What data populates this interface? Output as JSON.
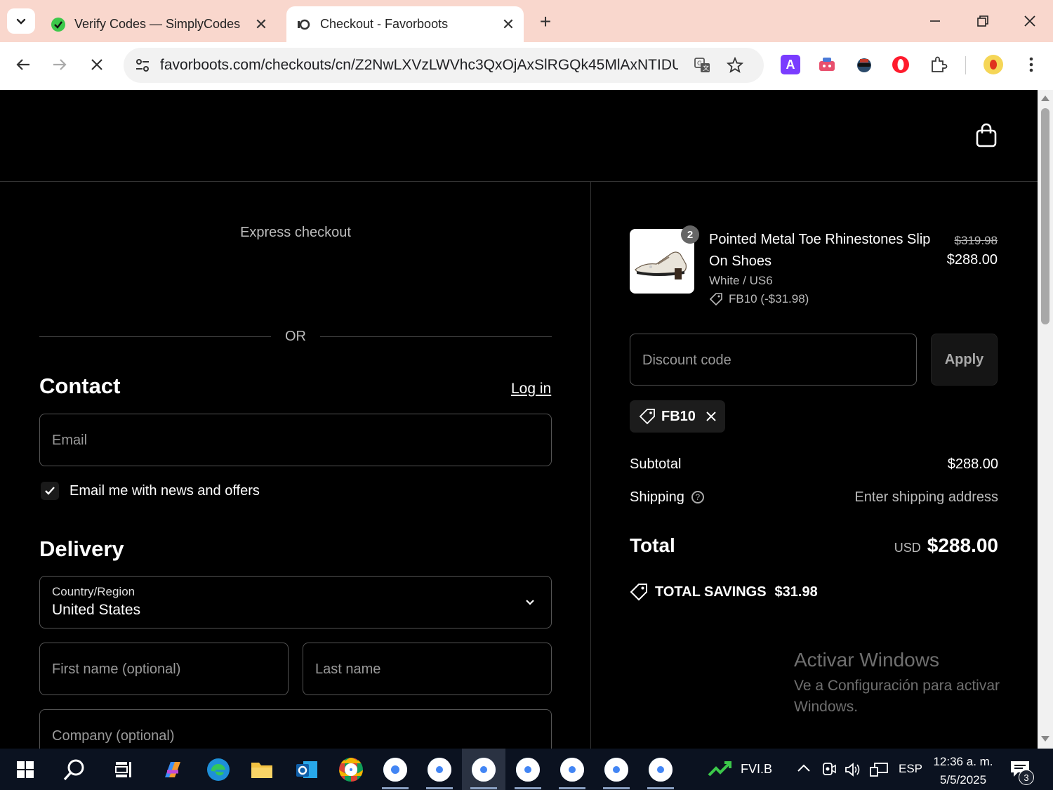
{
  "browser": {
    "tabs": [
      {
        "title": "Verify Codes — SimplyCodes",
        "active": false
      },
      {
        "title": "Checkout - Favorboots",
        "active": true
      }
    ],
    "url": "favorboots.com/checkouts/cn/Z2NwLXVzLWVhc3QxOjAxSlRGQk45MlAxNTIDUF..."
  },
  "checkout": {
    "express_label": "Express checkout",
    "or_label": "OR",
    "contact": {
      "heading": "Contact",
      "login_label": "Log in",
      "email_placeholder": "Email",
      "newsletter_label": "Email me with news and offers",
      "newsletter_checked": true
    },
    "delivery": {
      "heading": "Delivery",
      "country_label": "Country/Region",
      "country_value": "United States",
      "first_name_placeholder": "First name (optional)",
      "last_name_placeholder": "Last name",
      "company_placeholder": "Company (optional)"
    }
  },
  "summary": {
    "item": {
      "name": "Pointed Metal Toe Rhinestones Slip On Shoes",
      "quantity": "2",
      "variant": "White / US6",
      "discount": "FB10 (-$31.98)",
      "original_price": "$319.98",
      "price": "$288.00"
    },
    "discount_placeholder": "Discount code",
    "apply_label": "Apply",
    "applied_code": "FB10",
    "subtotal_label": "Subtotal",
    "subtotal_value": "$288.00",
    "shipping_label": "Shipping",
    "shipping_value": "Enter shipping address",
    "total_label": "Total",
    "total_currency": "USD",
    "total_value": "$288.00",
    "savings_label": "TOTAL SAVINGS",
    "savings_value": "$31.98"
  },
  "watermark": {
    "line1": "Activar Windows",
    "line2": "Ve a Configuración para activar",
    "line3": "Windows."
  },
  "taskbar": {
    "pinned_label": "FVI.B",
    "language": "ESP",
    "time": "12:36 a. m.",
    "date": "5/5/2025",
    "notification_count": "3"
  },
  "colors": {
    "tab_strip": "#f9d7cd",
    "page_background": "#000000",
    "taskbar": "#0b1220"
  }
}
